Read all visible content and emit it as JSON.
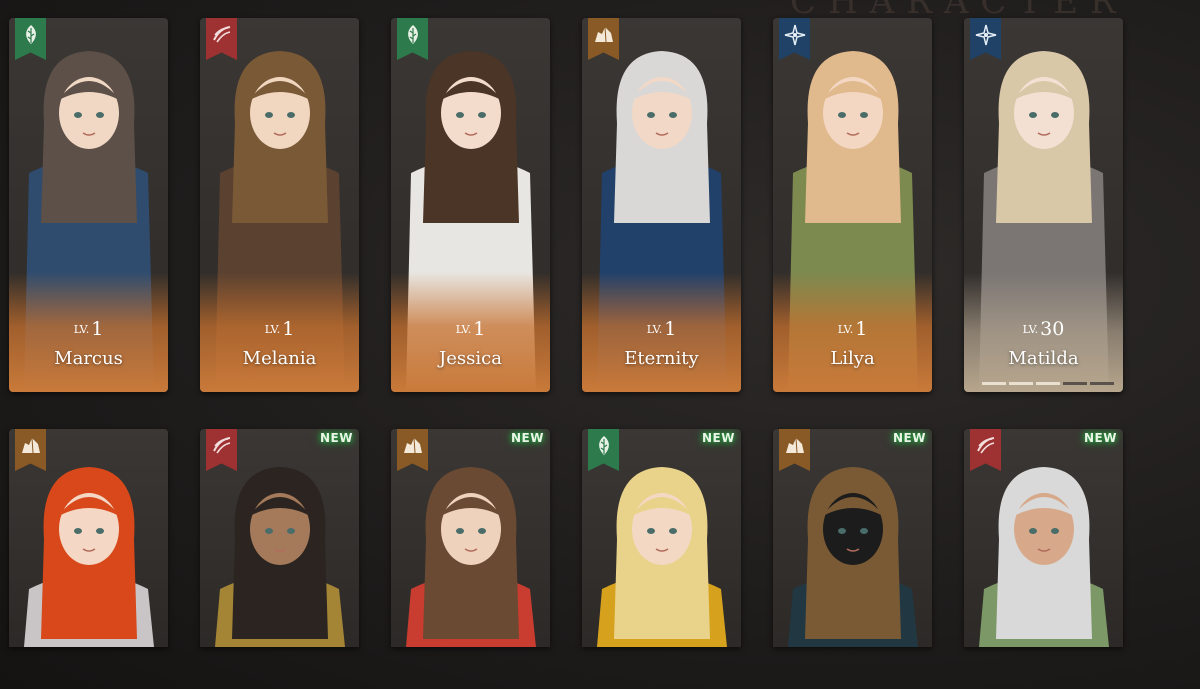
{
  "background_text": "CHARACTER",
  "lv_prefix": "LV.",
  "new_label": "NEW",
  "row1": [
    {
      "name": "Marcus",
      "level": "1",
      "badge": "leaf-icon",
      "badge_color": "green",
      "hair": "#5c5048",
      "outfit": "#2f4c6e",
      "skin": "#f1d8c4"
    },
    {
      "name": "Melania",
      "level": "1",
      "badge": "claw-icon",
      "badge_color": "red",
      "hair": "#7a5a36",
      "outfit": "#5a4130",
      "skin": "#f1d6c0"
    },
    {
      "name": "Jessica",
      "level": "1",
      "badge": "leaf-icon",
      "badge_color": "green",
      "hair": "#4a3526",
      "outfit": "#e8e6e2",
      "skin": "#f3dccb"
    },
    {
      "name": "Eternity",
      "level": "1",
      "badge": "rock-icon",
      "badge_color": "brown",
      "hair": "#d9d8d6",
      "outfit": "#21406a",
      "skin": "#f2d8c6"
    },
    {
      "name": "Lilya",
      "level": "1",
      "badge": "star-icon",
      "badge_color": "navy",
      "hair": "#e0b98c",
      "outfit": "#7c8a50",
      "skin": "#f3d7c2"
    },
    {
      "name": "Matilda",
      "level": "30",
      "badge": "star-icon",
      "badge_color": "navy",
      "hair": "#d8c8a8",
      "outfit": "#7b7674",
      "skin": "#f3e0d2"
    }
  ],
  "matilda_progress": {
    "filled": 3,
    "total": 5
  },
  "row2": [
    {
      "badge": "rock-icon",
      "badge_color": "brown",
      "new": false,
      "hair": "#d8481a",
      "outfit": "#c9c4c6",
      "skin": "#f4d7c4"
    },
    {
      "badge": "claw-icon",
      "badge_color": "red",
      "new": true,
      "hair": "#2b2420",
      "outfit": "#a48536",
      "skin": "#a57a5a"
    },
    {
      "badge": "rock-icon",
      "badge_color": "brown",
      "new": true,
      "hair": "#6a4a32",
      "outfit": "#c93c30",
      "skin": "#efd2bc"
    },
    {
      "badge": "leaf-icon",
      "badge_color": "green",
      "new": true,
      "hair": "#e9d38a",
      "outfit": "#d6a21e",
      "skin": "#f3d8c4"
    },
    {
      "badge": "rock-icon",
      "badge_color": "brown",
      "new": true,
      "hair": "#7a5a34",
      "outfit": "#213842",
      "skin": "#1c1c1c"
    },
    {
      "badge": "claw-icon",
      "badge_color": "red",
      "new": true,
      "hair": "#d9d9d9",
      "outfit": "#7c9866",
      "skin": "#d7a98a"
    }
  ]
}
